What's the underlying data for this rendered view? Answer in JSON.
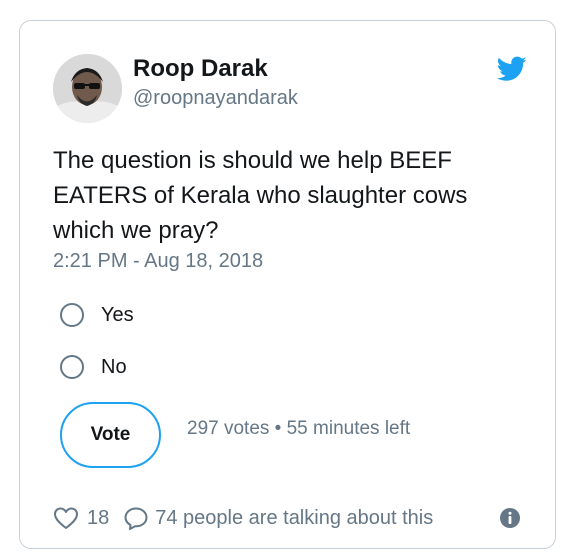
{
  "tweet": {
    "author_name": "Roop Darak",
    "author_handle": "@roopnayandarak",
    "text": "The question is should we help BEEF EATERS of Kerala who slaughter cows which we pray?",
    "timestamp": "2:21 PM - Aug 18, 2018"
  },
  "poll": {
    "options": [
      {
        "label": "Yes"
      },
      {
        "label": "No"
      }
    ],
    "vote_label": "Vote",
    "meta": "297 votes • 55 minutes left"
  },
  "footer": {
    "likes": "18",
    "talking": "74 people are talking about this"
  },
  "colors": {
    "brand": "#1da1f2",
    "text": "#14171a",
    "secondary": "#657786",
    "border": "#c9d1d8"
  },
  "icons": {
    "logo": "twitter-bird-icon",
    "like": "heart-icon",
    "reply": "reply-icon",
    "info": "info-icon"
  }
}
